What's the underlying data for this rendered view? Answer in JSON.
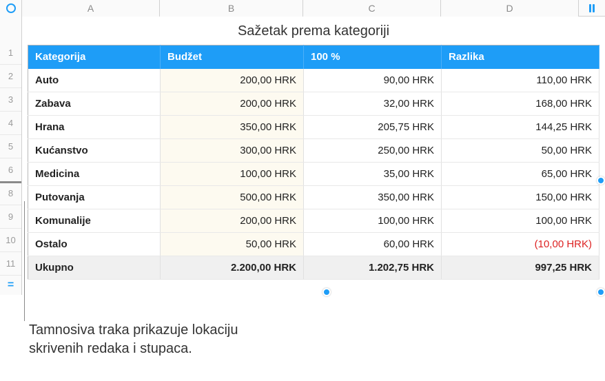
{
  "columns": {
    "A": "A",
    "B": "B",
    "C": "C",
    "D": "D"
  },
  "row_labels": [
    "1",
    "2",
    "3",
    "4",
    "5",
    "6",
    "8",
    "9",
    "10",
    "11"
  ],
  "title": "Sažetak prema kategoriji",
  "headers": {
    "category": "Kategorija",
    "budget": "Budžet",
    "percent": "100 %",
    "diff": "Razlika"
  },
  "rows": [
    {
      "cat": "Auto",
      "budget": "200,00 HRK",
      "pct": "90,00 HRK",
      "diff": "110,00 HRK"
    },
    {
      "cat": "Zabava",
      "budget": "200,00 HRK",
      "pct": "32,00 HRK",
      "diff": "168,00 HRK"
    },
    {
      "cat": "Hrana",
      "budget": "350,00 HRK",
      "pct": "205,75 HRK",
      "diff": "144,25 HRK"
    },
    {
      "cat": "Kućanstvo",
      "budget": "300,00 HRK",
      "pct": "250,00 HRK",
      "diff": "50,00 HRK"
    },
    {
      "cat": "Medicina",
      "budget": "100,00 HRK",
      "pct": "35,00 HRK",
      "diff": "65,00 HRK"
    },
    {
      "cat": "Putovanja",
      "budget": "500,00 HRK",
      "pct": "350,00 HRK",
      "diff": "150,00 HRK"
    },
    {
      "cat": "Komunalije",
      "budget": "200,00 HRK",
      "pct": "100,00 HRK",
      "diff": "100,00 HRK"
    },
    {
      "cat": "Ostalo",
      "budget": "50,00 HRK",
      "pct": "60,00 HRK",
      "diff": "(10,00 HRK)",
      "neg": true
    }
  ],
  "total": {
    "label": "Ukupno",
    "budget": "2.200,00 HRK",
    "pct": "1.202,75 HRK",
    "diff": "997,25 HRK"
  },
  "callout": "Tamnosiva traka prikazuje lokaciju\nskrivenih redaka i stupaca."
}
